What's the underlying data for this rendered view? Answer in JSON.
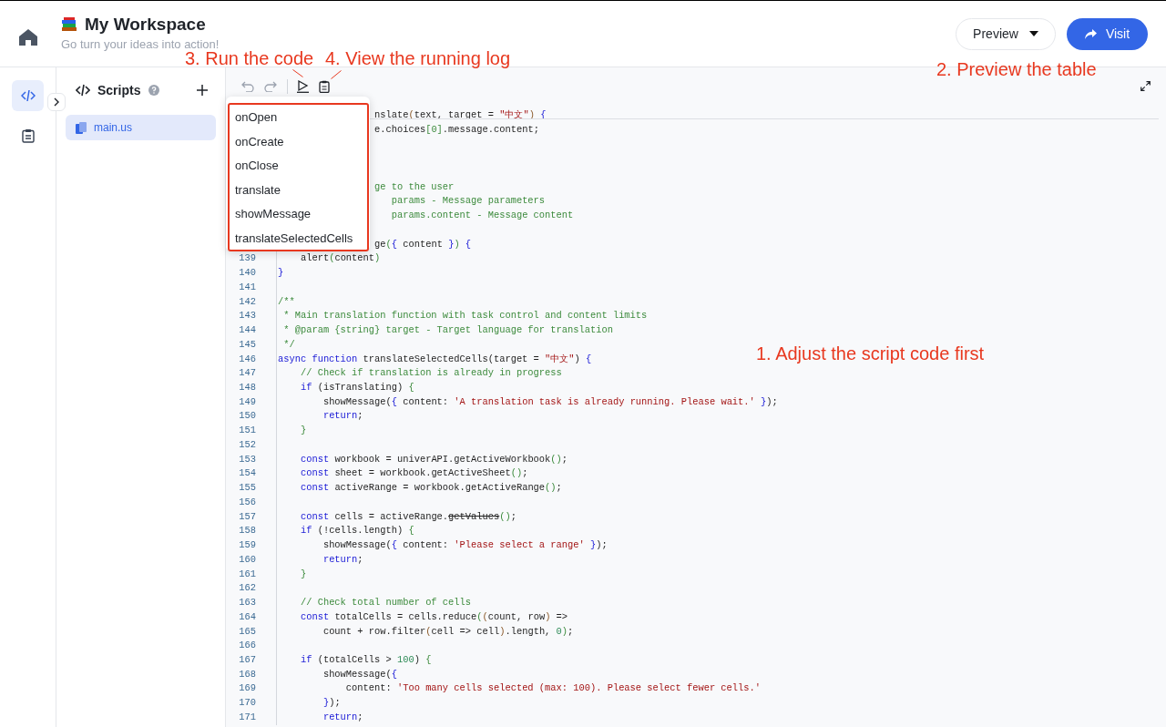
{
  "header": {
    "title": "My Workspace",
    "subtitle": "Go turn your ideas into action!",
    "buttons": [
      {
        "label": "Preview",
        "kind": "dropdown"
      },
      {
        "label": "Visit",
        "kind": "primary"
      }
    ]
  },
  "rail": [
    {
      "kind": "code",
      "selected": true
    },
    {
      "kind": "log",
      "selected": false
    }
  ],
  "sidebar": {
    "title": "Scripts",
    "files": [
      {
        "name": "main.us",
        "selected": true
      }
    ]
  },
  "function_menu": {
    "items": [
      "onOpen",
      "onCreate",
      "onClose",
      "translate",
      "showMessage",
      "translateSelectedCells"
    ]
  },
  "editor": {
    "lines": [
      {
        "kind": "code",
        "tokens": [
          {
            "kind": "txt",
            "text": "                 nslate"
          },
          {
            "kind": "b3",
            "text": "("
          },
          {
            "kind": "txt",
            "text": "text, target = "
          },
          {
            "kind": "str",
            "text": "\"中文\""
          },
          {
            "kind": "b3",
            "text": ")"
          },
          {
            "kind": "b1",
            "text": " {"
          }
        ]
      },
      {
        "kind": "code",
        "tokens": [
          {
            "kind": "txt",
            "text": "                 e.choices"
          },
          {
            "kind": "b2",
            "text": "[0]"
          },
          {
            "kind": "txt",
            "text": ".message.content;"
          }
        ]
      },
      {
        "kind": "blank"
      },
      {
        "kind": "blank"
      },
      {
        "kind": "blank"
      },
      {
        "kind": "code",
        "tokens": [
          {
            "kind": "com",
            "text": "                 ge to the user"
          }
        ]
      },
      {
        "kind": "code",
        "tokens": [
          {
            "kind": "com",
            "text": "                    params - Message parameters"
          }
        ]
      },
      {
        "kind": "code",
        "tokens": [
          {
            "kind": "com",
            "text": "                    params.content - Message content"
          }
        ]
      },
      {
        "kind": "blank"
      },
      {
        "kind": "code",
        "tokens": [
          {
            "kind": "txt",
            "text": "                 ge"
          },
          {
            "kind": "b2",
            "text": "("
          },
          {
            "kind": "b1",
            "text": "{"
          },
          {
            "kind": "txt",
            "text": " content "
          },
          {
            "kind": "b1",
            "text": "}"
          },
          {
            "kind": "b2",
            "text": ")"
          },
          {
            "kind": "b1",
            "text": " {"
          }
        ]
      },
      {
        "kind": "code",
        "number": "139",
        "tokens": [
          {
            "kind": "txt",
            "text": "    alert"
          },
          {
            "kind": "b2",
            "text": "("
          },
          {
            "kind": "txt",
            "text": "content"
          },
          {
            "kind": "b2",
            "text": ")"
          }
        ]
      },
      {
        "kind": "code",
        "number": "140",
        "tokens": [
          {
            "kind": "b1",
            "text": "}"
          }
        ]
      },
      {
        "kind": "code",
        "number": "141"
      },
      {
        "kind": "code",
        "number": "142",
        "tokens": [
          {
            "kind": "com",
            "text": "/**"
          }
        ]
      },
      {
        "kind": "code",
        "number": "143",
        "tokens": [
          {
            "kind": "com",
            "text": " * Main translation function with task control and content limits"
          }
        ]
      },
      {
        "kind": "code",
        "number": "144",
        "tokens": [
          {
            "kind": "com",
            "text": " * @param {string} target - Target language for translation"
          }
        ]
      },
      {
        "kind": "code",
        "number": "145",
        "tokens": [
          {
            "kind": "com",
            "text": " */"
          }
        ]
      },
      {
        "kind": "code",
        "number": "146",
        "tokens": [
          {
            "kind": "kw",
            "text": "async function"
          },
          {
            "kind": "txt",
            "text": " translateSelectedCells(target = "
          },
          {
            "kind": "str",
            "text": "\"中文\""
          },
          {
            "kind": "txt",
            "text": ")"
          },
          {
            "kind": "b1",
            "text": " {"
          }
        ]
      },
      {
        "kind": "code",
        "number": "147",
        "tokens": [
          {
            "kind": "com",
            "text": "    // Check if translation is already in progress"
          }
        ]
      },
      {
        "kind": "code",
        "number": "148",
        "tokens": [
          {
            "kind": "kw",
            "text": "    if"
          },
          {
            "kind": "txt",
            "text": " (isTranslating)"
          },
          {
            "kind": "b2",
            "text": " {"
          }
        ]
      },
      {
        "kind": "code",
        "number": "149",
        "tokens": [
          {
            "kind": "txt",
            "text": "        showMessage("
          },
          {
            "kind": "b1",
            "text": "{"
          },
          {
            "kind": "txt",
            "text": " content: "
          },
          {
            "kind": "str",
            "text": "'A translation task is already running. Please wait.'"
          },
          {
            "kind": "b1",
            "text": " }"
          },
          {
            "kind": "txt",
            "text": ");"
          }
        ]
      },
      {
        "kind": "code",
        "number": "150",
        "tokens": [
          {
            "kind": "kw",
            "text": "        return"
          },
          {
            "kind": "txt",
            "text": ";"
          }
        ]
      },
      {
        "kind": "code",
        "number": "151",
        "tokens": [
          {
            "kind": "b2",
            "text": "    }"
          }
        ]
      },
      {
        "kind": "code",
        "number": "152"
      },
      {
        "kind": "code",
        "number": "153",
        "tokens": [
          {
            "kind": "kw",
            "text": "    const"
          },
          {
            "kind": "txt",
            "text": " workbook = univerAPI.getActiveWorkbook"
          },
          {
            "kind": "b2",
            "text": "()"
          },
          {
            "kind": "txt",
            "text": ";"
          }
        ]
      },
      {
        "kind": "code",
        "number": "154",
        "tokens": [
          {
            "kind": "kw",
            "text": "    const"
          },
          {
            "kind": "txt",
            "text": " sheet = workbook.getActiveSheet"
          },
          {
            "kind": "b2",
            "text": "()"
          },
          {
            "kind": "txt",
            "text": ";"
          }
        ]
      },
      {
        "kind": "code",
        "number": "155",
        "tokens": [
          {
            "kind": "kw",
            "text": "    const"
          },
          {
            "kind": "txt",
            "text": " activeRange = workbook.getActiveRange"
          },
          {
            "kind": "b2",
            "text": "()"
          },
          {
            "kind": "txt",
            "text": ";"
          }
        ]
      },
      {
        "kind": "code",
        "number": "156"
      },
      {
        "kind": "code",
        "number": "157",
        "tokens": [
          {
            "kind": "kw",
            "text": "    const"
          },
          {
            "kind": "txt",
            "text": " cells = activeRange."
          },
          {
            "kind": "dep",
            "text": "getValues"
          },
          {
            "kind": "b2",
            "text": "()"
          },
          {
            "kind": "txt",
            "text": ";"
          }
        ]
      },
      {
        "kind": "code",
        "number": "158",
        "tokens": [
          {
            "kind": "kw",
            "text": "    if"
          },
          {
            "kind": "txt",
            "text": " (!cells.length)"
          },
          {
            "kind": "b2",
            "text": " {"
          }
        ]
      },
      {
        "kind": "code",
        "number": "159",
        "tokens": [
          {
            "kind": "txt",
            "text": "        showMessage("
          },
          {
            "kind": "b1",
            "text": "{"
          },
          {
            "kind": "txt",
            "text": " content: "
          },
          {
            "kind": "str",
            "text": "'Please select a range'"
          },
          {
            "kind": "b1",
            "text": " }"
          },
          {
            "kind": "txt",
            "text": ");"
          }
        ]
      },
      {
        "kind": "code",
        "number": "160",
        "tokens": [
          {
            "kind": "kw",
            "text": "        return"
          },
          {
            "kind": "txt",
            "text": ";"
          }
        ]
      },
      {
        "kind": "code",
        "number": "161",
        "tokens": [
          {
            "kind": "b2",
            "text": "    }"
          }
        ]
      },
      {
        "kind": "code",
        "number": "162"
      },
      {
        "kind": "code",
        "number": "163",
        "tokens": [
          {
            "kind": "com",
            "text": "    // Check total number of cells"
          }
        ]
      },
      {
        "kind": "code",
        "number": "164",
        "tokens": [
          {
            "kind": "kw",
            "text": "    const"
          },
          {
            "kind": "txt",
            "text": " totalCells = cells.reduce"
          },
          {
            "kind": "b2",
            "text": "("
          },
          {
            "kind": "b3",
            "text": "("
          },
          {
            "kind": "txt",
            "text": "count, row"
          },
          {
            "kind": "b3",
            "text": ")"
          },
          {
            "kind": "txt",
            "text": " =>"
          }
        ]
      },
      {
        "kind": "code",
        "number": "165",
        "tokens": [
          {
            "kind": "txt",
            "text": "        count + row.filter"
          },
          {
            "kind": "b3",
            "text": "("
          },
          {
            "kind": "txt",
            "text": "cell => cell"
          },
          {
            "kind": "b3",
            "text": ")"
          },
          {
            "kind": "txt",
            "text": ".length, "
          },
          {
            "kind": "num",
            "text": "0"
          },
          {
            "kind": "b2",
            "text": ")"
          },
          {
            "kind": "txt",
            "text": ";"
          }
        ]
      },
      {
        "kind": "code",
        "number": "166"
      },
      {
        "kind": "code",
        "number": "167",
        "tokens": [
          {
            "kind": "kw",
            "text": "    if"
          },
          {
            "kind": "txt",
            "text": " (totalCells > "
          },
          {
            "kind": "num",
            "text": "100"
          },
          {
            "kind": "txt",
            "text": ")"
          },
          {
            "kind": "b2",
            "text": " {"
          }
        ]
      },
      {
        "kind": "code",
        "number": "168",
        "tokens": [
          {
            "kind": "txt",
            "text": "        showMessage("
          },
          {
            "kind": "b1",
            "text": "{"
          }
        ]
      },
      {
        "kind": "code",
        "number": "169",
        "tokens": [
          {
            "kind": "txt",
            "text": "            content: "
          },
          {
            "kind": "str",
            "text": "'Too many cells selected (max: 100). Please select fewer cells.'"
          }
        ]
      },
      {
        "kind": "code",
        "number": "170",
        "tokens": [
          {
            "kind": "b1",
            "text": "        }"
          },
          {
            "kind": "txt",
            "text": ");"
          }
        ]
      },
      {
        "kind": "code",
        "number": "171",
        "tokens": [
          {
            "kind": "kw",
            "text": "        return"
          },
          {
            "kind": "txt",
            "text": ";"
          }
        ]
      }
    ]
  },
  "annotations": [
    {
      "text": "3. Run the code"
    },
    {
      "text": "4. View the running log"
    },
    {
      "text": "2. Preview the table"
    },
    {
      "text": "1. Adjust the script code first"
    }
  ]
}
